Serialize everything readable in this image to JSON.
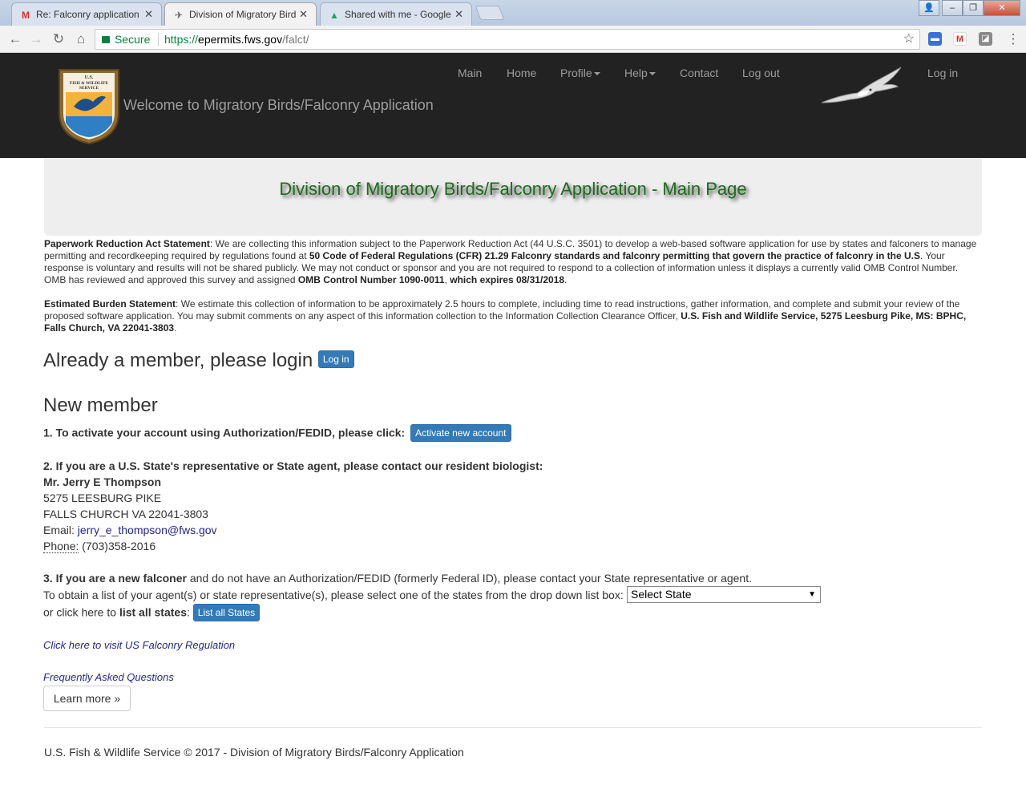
{
  "browser": {
    "tabs": [
      {
        "title": "Re: Falconry application",
        "icon": "gmail-icon"
      },
      {
        "title": "Division of Migratory Bird",
        "icon": "hawk-icon"
      },
      {
        "title": "Shared with me - Google",
        "icon": "google-drive-icon"
      }
    ],
    "secure_label": "Secure",
    "url": {
      "proto": "https://",
      "host": "epermits.fws.gov",
      "path": "/falct/"
    }
  },
  "navbar": {
    "logo_text": [
      "U.S.",
      "FISH & WILDLIFE",
      "SERVICE"
    ],
    "brand": "Welcome to Migratory Birds/Falconry Application",
    "links": {
      "main": "Main",
      "home": "Home",
      "profile": "Profile",
      "help": "Help",
      "contact": "Contact",
      "logout": "Log out",
      "login": "Log in"
    }
  },
  "jumbotron": {
    "title": "Division of Migratory Birds/Falconry Application - Main Page"
  },
  "paperwork": {
    "label": "Paperwork Reduction Act Statement",
    "text1": ": We are collecting this information subject to the Paperwork Reduction Act (44 U.S.C. 3501) to develop a web-based software application for use by states and falconers to manage permitting and recordkeeping required by regulations found at ",
    "bold1": "50 Code of Federal Regulations (CFR) 21.29 Falconry standards and falconry permitting that govern the practice of falconry in the U.S",
    "text2": ". Your response is voluntary and results will not be shared publicly. We may not conduct or sponsor and you are not required to respond to a collection of information unless it displays a currently valid OMB Control Number. OMB has reviewed and approved this survey and assigned ",
    "bold2": "OMB Control Number 1090-0011",
    "text3": ", ",
    "bold3": "which expires 08/31/2018",
    "text4": "."
  },
  "burden": {
    "label": "Estimated Burden Statement",
    "text1": ": We estimate this collection of information to be approximately 2.5 hours to complete, including time to read instructions, gather information, and complete and submit your review of the proposed software application. You may submit comments on any aspect of this information collection to the Information Collection Clearance Officer, ",
    "bold1": "U.S. Fish and Wildlife Service, 5275 Leesburg Pike, MS: BPHC, Falls Church, VA 22041-3803",
    "text2": "."
  },
  "login_section": {
    "heading": "Already a member, please login",
    "button": "Log in"
  },
  "new_member": {
    "heading": "New member",
    "step1": "1. To activate your account using Authorization/FEDID, please click:",
    "activate_button": "Activate new account",
    "step2": "2. If you are a U.S. State's representative or State agent, please contact our resident biologist:",
    "contact_name": "Mr. Jerry E Thompson",
    "address1": "5275 LEESBURG PIKE",
    "address2": "FALLS CHURCH VA 22041-3803",
    "email_label": "Email:",
    "email": "jerry_e_thompson@fws.gov",
    "phone_label": "Phone:",
    "phone": "(703)358-2016",
    "step3_bold": "3. If you are a new falconer",
    "step3_text": " and do not have an Authorization/FEDID (formerly Federal ID), please contact  your State representative or agent.",
    "obtain_text": "To obtain a list of your agent(s) or state representative(s), please select one of the states from the drop down list box:",
    "select_value": "Select State",
    "or_click": "or click here to ",
    "list_all_bold": "list all states",
    "colon": ":",
    "list_button": "List all States"
  },
  "links": {
    "regulation": "Click here to visit US Falconry Regulation",
    "faq": "Frequently Asked Questions",
    "learn_more": "Learn more »"
  },
  "footer": {
    "text": "U.S. Fish & Wildlife Service © 2017 - Division of Migratory Birds/Falconry Application"
  }
}
